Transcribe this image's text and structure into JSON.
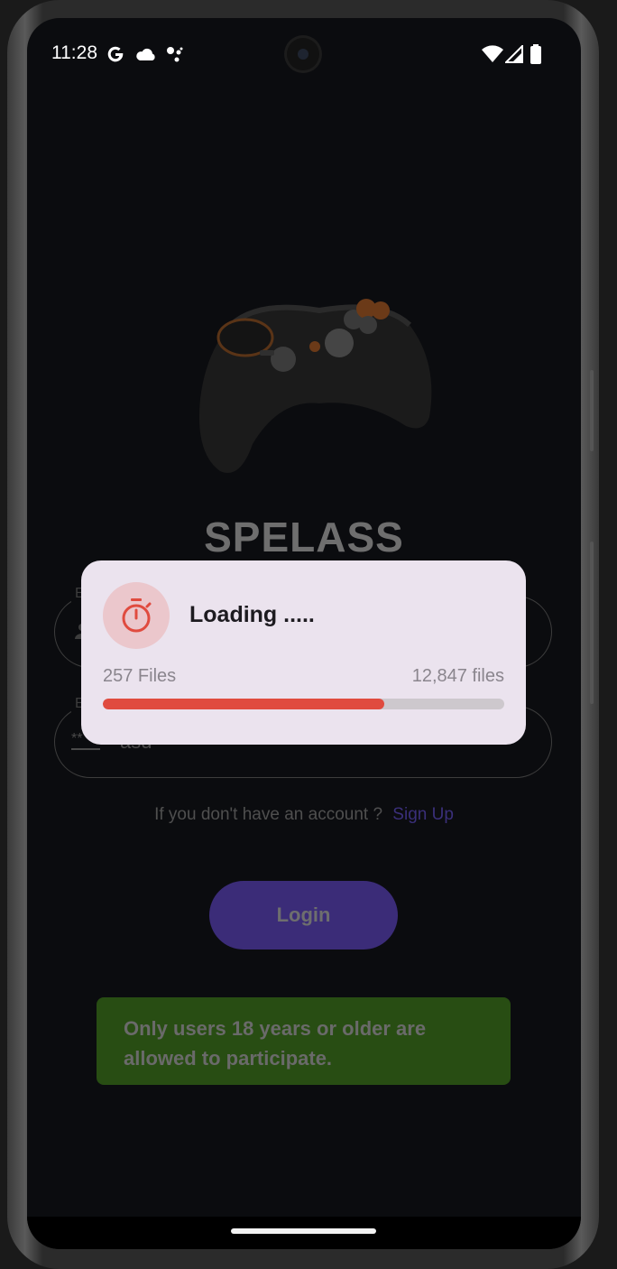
{
  "status_bar": {
    "time": "11:28",
    "left_icons": [
      "google-icon",
      "cloud-icon",
      "assistant-dots-icon"
    ],
    "right_icons": [
      "wifi-icon",
      "signal-icon",
      "battery-icon"
    ]
  },
  "app": {
    "title": "SPELASS",
    "logo_icon": "gamepad-icon"
  },
  "form": {
    "email_field": {
      "label": "E",
      "icon": "person-icon"
    },
    "password_field": {
      "label": "E",
      "icon": "password-icon",
      "value": "asd"
    }
  },
  "signup": {
    "question": "If you don't have an account ?",
    "link": "Sign Up"
  },
  "login_button": {
    "label": "Login"
  },
  "age_notice": {
    "text": "Only users 18 years or older are allowed to participate."
  },
  "loading_dialog": {
    "icon": "stopwatch-icon",
    "title": "Loading .....",
    "left_label": "257 Files",
    "right_label": "12,847 files",
    "progress_fraction": 0.7
  },
  "colors": {
    "background": "#0b0c0f",
    "dialog_background": "#ebe3ee",
    "progress_fill": "#e04b3f",
    "progress_track": "#cdc8cd",
    "login_button": "#3b2c78",
    "age_notice": "#284d13",
    "signup_link": "#3a2f7a"
  }
}
